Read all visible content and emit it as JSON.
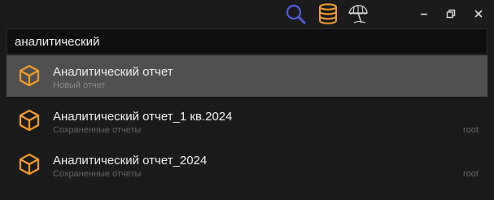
{
  "search": {
    "value": "аналитический"
  },
  "results": [
    {
      "title": "Аналитический отчет",
      "subtitle": "Новый отчет",
      "owner": ""
    },
    {
      "title": "Аналитический отчет_1 кв.2024",
      "subtitle": "Сохраненные отчеты",
      "owner": "root"
    },
    {
      "title": "Аналитический отчет_2024",
      "subtitle": "Сохраненные отчеты",
      "owner": "root"
    }
  ],
  "colors": {
    "accent_orange": "#f39c2a",
    "search_icon_blue": "#4f5ce0",
    "selected_row": "#505050",
    "background": "#1b1b1b"
  },
  "icons": {
    "toolbar": [
      "search-icon",
      "database-icon",
      "beach-umbrella-icon"
    ],
    "window": [
      "minimize-icon",
      "restore-icon",
      "close-icon"
    ],
    "result": "cube-icon"
  }
}
